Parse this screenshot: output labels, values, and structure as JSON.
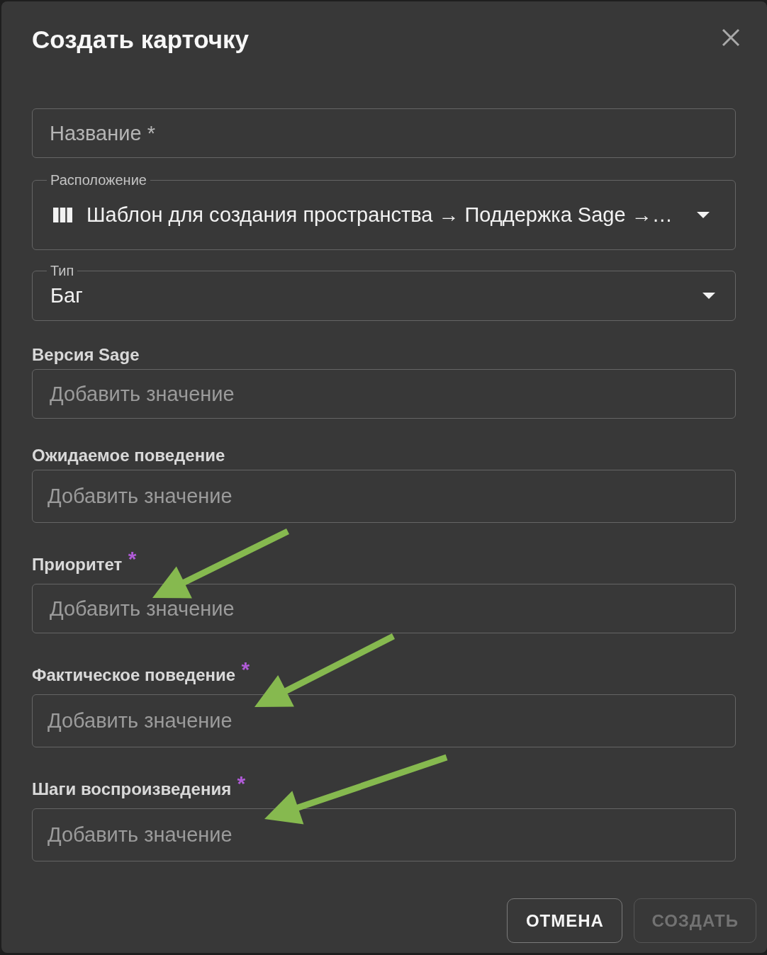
{
  "dialog": {
    "title": "Создать карточку"
  },
  "name_field": {
    "placeholder": "Название *"
  },
  "location_field": {
    "label": "Расположение",
    "value": "Шаблон для создания пространства → Поддержка Sage →…"
  },
  "type_field": {
    "label": "Тип",
    "value": "Баг"
  },
  "custom_fields": [
    {
      "label": "Версия Sage",
      "kind": "single_line",
      "placeholder": "Добавить значение",
      "annotated": false
    },
    {
      "label": "Ожидаемое поведение",
      "kind": "multi_line",
      "placeholder": "Добавить значение",
      "annotated": false
    },
    {
      "label": "Приоритет",
      "required_mark": "*",
      "kind": "single_line",
      "placeholder": "Добавить значение",
      "annotated": true
    },
    {
      "label": "Фактическое поведение",
      "required_mark": "*",
      "kind": "multi_line",
      "placeholder": "Добавить значение",
      "annotated": true
    },
    {
      "label": "Шаги воспроизведения",
      "required_mark": "*",
      "kind": "multi_line",
      "placeholder": "Добавить значение",
      "annotated": true
    }
  ],
  "buttons": [
    {
      "label": "ОТМЕНА",
      "disabled": false
    },
    {
      "label": "СОЗДАТЬ",
      "disabled": true
    }
  ]
}
